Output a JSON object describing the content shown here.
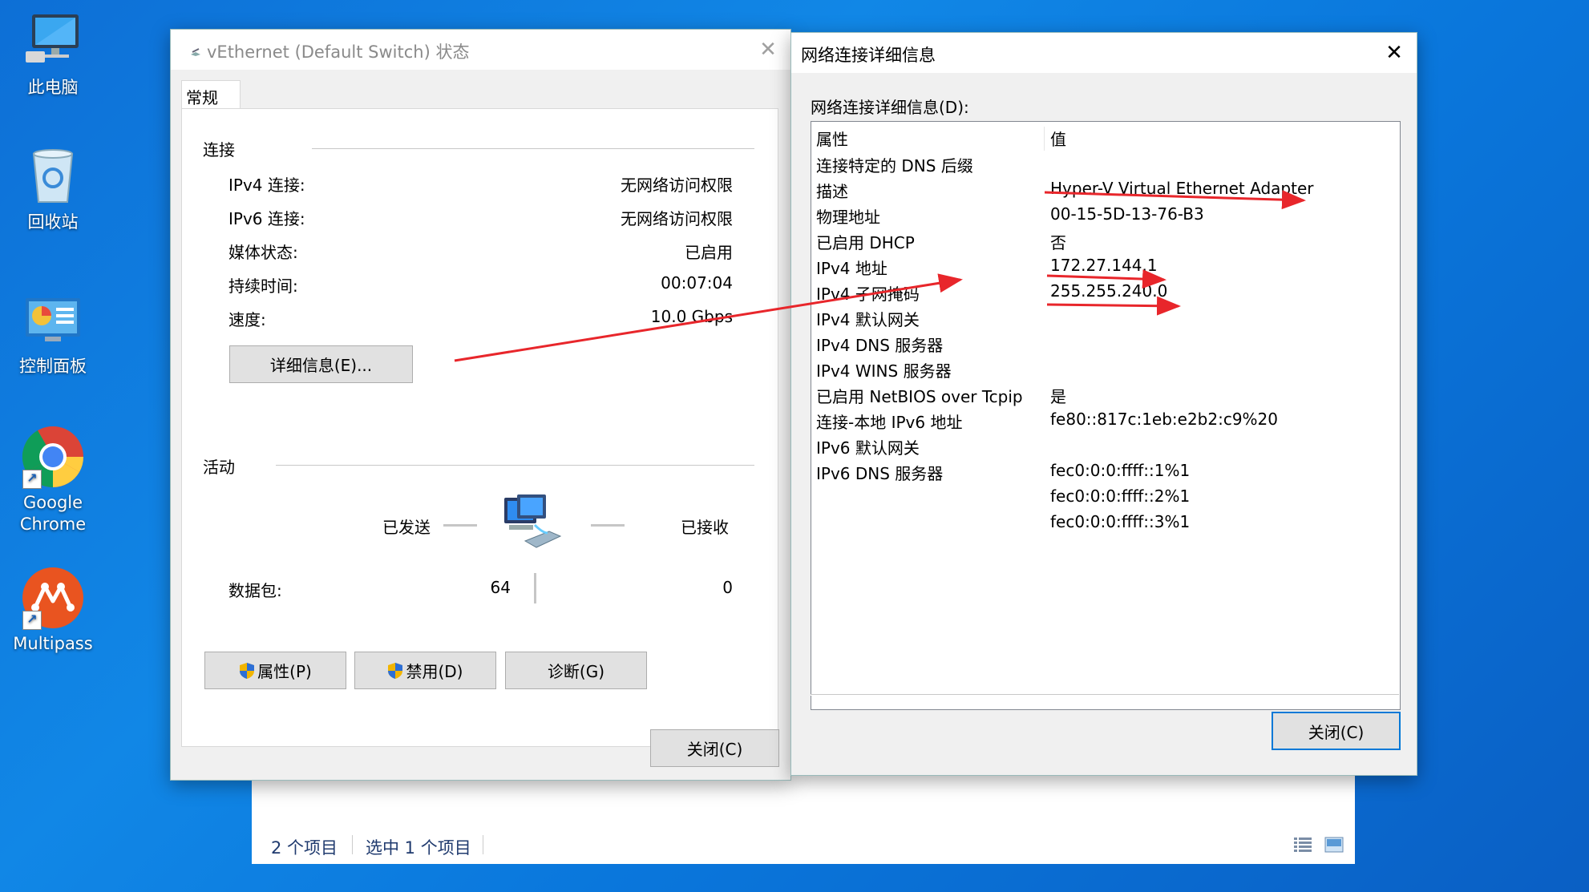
{
  "desktop": {
    "icons": [
      {
        "label": "此电脑",
        "icon": "computer-icon"
      },
      {
        "label": "回收站",
        "icon": "recycle-bin-icon"
      },
      {
        "label": "控制面板",
        "icon": "control-panel-icon"
      },
      {
        "label": "Google Chrome",
        "line1": "Google",
        "line2": "Chrome",
        "icon": "chrome-icon"
      },
      {
        "label": "Multipass",
        "icon": "multipass-icon"
      }
    ]
  },
  "explorer": {
    "item_count": "2 个项目",
    "selected": "选中 1 个项目"
  },
  "status_window": {
    "title": "vEthernet (Default Switch) 状态",
    "tab": "常规",
    "connection_group": "连接",
    "rows": [
      {
        "label": "IPv4 连接:",
        "value": "无网络访问权限"
      },
      {
        "label": "IPv6 连接:",
        "value": "无网络访问权限"
      },
      {
        "label": "媒体状态:",
        "value": "已启用"
      },
      {
        "label": "持续时间:",
        "value": "00:07:04"
      },
      {
        "label": "速度:",
        "value": "10.0 Gbps"
      }
    ],
    "details_button": "详细信息(E)...",
    "activity_group": "活动",
    "sent_label": "已发送",
    "received_label": "已接收",
    "packets_label": "数据包:",
    "packets_sent": "64",
    "packets_received": "0",
    "properties_button": "属性(P)",
    "disable_button": "禁用(D)",
    "diagnose_button": "诊断(G)",
    "close_button": "关闭(C)"
  },
  "details_window": {
    "title": "网络连接详细信息",
    "list_label": "网络连接详细信息(D):",
    "col_property": "属性",
    "col_value": "值",
    "rows": [
      {
        "property": "连接特定的 DNS 后缀",
        "value": ""
      },
      {
        "property": "描述",
        "value": "Hyper-V Virtual Ethernet Adapter"
      },
      {
        "property": "物理地址",
        "value": "00-15-5D-13-76-B3"
      },
      {
        "property": "已启用 DHCP",
        "value": "否"
      },
      {
        "property": "IPv4 地址",
        "value": "172.27.144.1"
      },
      {
        "property": "IPv4 子网掩码",
        "value": "255.255.240.0"
      },
      {
        "property": "IPv4 默认网关",
        "value": ""
      },
      {
        "property": "IPv4 DNS 服务器",
        "value": ""
      },
      {
        "property": "IPv4 WINS 服务器",
        "value": ""
      },
      {
        "property": "已启用 NetBIOS over Tcpip",
        "value": "是"
      },
      {
        "property": "连接-本地 IPv6 地址",
        "value": "fe80::817c:1eb:e2b2:c9%20"
      },
      {
        "property": "IPv6 默认网关",
        "value": ""
      },
      {
        "property": "IPv6 DNS 服务器",
        "value": "fec0:0:0:ffff::1%1"
      },
      {
        "property": "",
        "value": "fec0:0:0:ffff::2%1"
      },
      {
        "property": "",
        "value": "fec0:0:0:ffff::3%1"
      }
    ],
    "close_button": "关闭(C)"
  },
  "colors": {
    "annotation": "#e8262b",
    "accent": "#0078d7"
  }
}
